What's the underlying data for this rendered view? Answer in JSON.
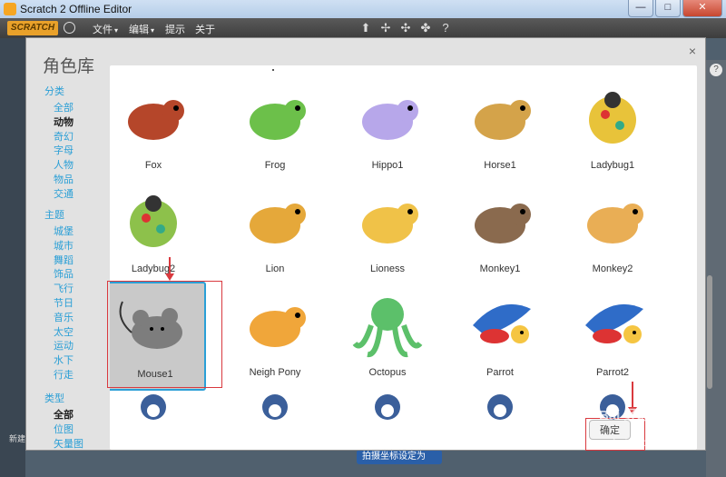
{
  "window": {
    "title": "Scratch 2 Offline Editor",
    "controls": [
      "—",
      "□",
      "✕"
    ]
  },
  "menubar": {
    "logo": "SCRATCH",
    "items": [
      {
        "label": "文件",
        "caret": "▾"
      },
      {
        "label": "编辑",
        "caret": "▾"
      },
      {
        "label": "提示",
        "caret": ""
      },
      {
        "label": "关于",
        "caret": ""
      }
    ],
    "tool_icons": [
      "stamp-icon",
      "cut-icon",
      "grow-icon",
      "shrink-icon",
      "help-icon"
    ]
  },
  "dialog": {
    "title": "角色库",
    "close": "×",
    "ok_label": "确定",
    "sidebar": {
      "sections": [
        {
          "header": "分类",
          "items": [
            {
              "label": "全部",
              "active": false
            },
            {
              "label": "动物",
              "active": true
            },
            {
              "label": "奇幻",
              "active": false
            },
            {
              "label": "字母",
              "active": false
            },
            {
              "label": "人物",
              "active": false
            },
            {
              "label": "物品",
              "active": false
            },
            {
              "label": "交通",
              "active": false
            }
          ]
        },
        {
          "header": "主题",
          "items": [
            {
              "label": "城堡",
              "active": false
            },
            {
              "label": "城市",
              "active": false
            },
            {
              "label": "舞蹈",
              "active": false
            },
            {
              "label": "饰品",
              "active": false
            },
            {
              "label": "飞行",
              "active": false
            },
            {
              "label": "节日",
              "active": false
            },
            {
              "label": "音乐",
              "active": false
            },
            {
              "label": "太空",
              "active": false
            },
            {
              "label": "运动",
              "active": false
            },
            {
              "label": "水下",
              "active": false
            },
            {
              "label": "行走",
              "active": false
            }
          ]
        },
        {
          "header": "类型",
          "items": [
            {
              "label": "全部",
              "active": true
            },
            {
              "label": "位图",
              "active": false
            },
            {
              "label": "矢量图",
              "active": false
            }
          ]
        }
      ]
    },
    "sprites": [
      {
        "name": "Fox",
        "icon": "fox-sprite",
        "color": "#b5462a"
      },
      {
        "name": "Frog",
        "icon": "frog-sprite",
        "color": "#6cc04a"
      },
      {
        "name": "Hippo1",
        "icon": "hippo-sprite",
        "color": "#b7a7ea"
      },
      {
        "name": "Horse1",
        "icon": "horse-sprite",
        "color": "#d4a34a"
      },
      {
        "name": "Ladybug1",
        "icon": "ladybug-sprite",
        "color": "#e8c33a"
      },
      {
        "name": "Ladybug2",
        "icon": "ladybug2-sprite",
        "color": "#8dc14b"
      },
      {
        "name": "Lion",
        "icon": "lion-sprite",
        "color": "#e5a83a"
      },
      {
        "name": "Lioness",
        "icon": "lioness-sprite",
        "color": "#f0c248"
      },
      {
        "name": "Monkey1",
        "icon": "monkey-sprite",
        "color": "#8a6a4e"
      },
      {
        "name": "Monkey2",
        "icon": "monkey2-sprite",
        "color": "#e9ae55"
      },
      {
        "name": "Mouse1",
        "icon": "mouse-sprite",
        "color": "#7d7d7d",
        "selected": true
      },
      {
        "name": "Neigh Pony",
        "icon": "pony-sprite",
        "color": "#f0a63a"
      },
      {
        "name": "Octopus",
        "icon": "octopus-sprite",
        "color": "#5cc06a"
      },
      {
        "name": "Parrot",
        "icon": "parrot-sprite",
        "color": "#2f6cc8"
      },
      {
        "name": "Parrot2",
        "icon": "parrot2-sprite",
        "color": "#2f6cc8"
      }
    ]
  },
  "background": {
    "new_sprite_label": "新建",
    "blue_button": "拍摄坐标设定为",
    "help": "?"
  },
  "watermark": {
    "line1": "Bai 经验",
    "line2": "m.baidu.c"
  },
  "accent": "#2a9fd6"
}
